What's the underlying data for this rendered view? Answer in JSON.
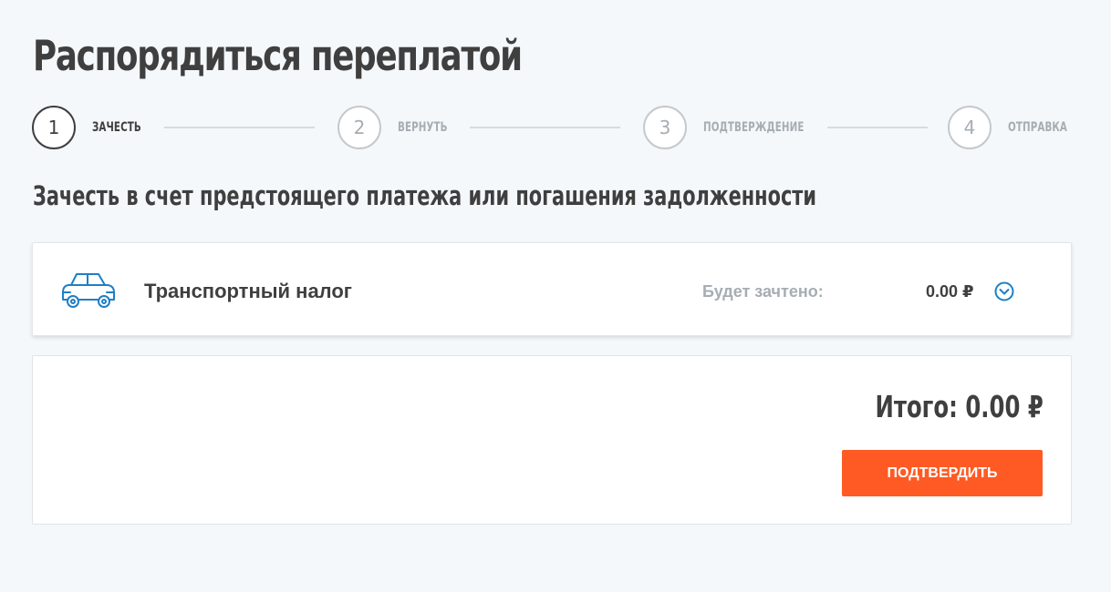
{
  "page_title": "Распорядиться переплатой",
  "stepper": {
    "steps": [
      {
        "number": "1",
        "label": "ЗАЧЕСТЬ",
        "active": true
      },
      {
        "number": "2",
        "label": "ВЕРНУТЬ",
        "active": false
      },
      {
        "number": "3",
        "label": "ПОДТВЕРЖДЕНИЕ",
        "active": false
      },
      {
        "number": "4",
        "label": "ОТПРАВКА",
        "active": false
      }
    ]
  },
  "section_title": "Зачесть в счет предстоящего платежа или погашения задолженности",
  "tax_item": {
    "icon": "car-icon",
    "name": "Транспортный налог",
    "credited_label": "Будет зачтено:",
    "credited_amount": "0.00 ₽",
    "expand_icon": "chevron-down-circle-icon"
  },
  "summary": {
    "total": "Итого: 0.00 ₽",
    "confirm_label": "ПОДТВЕРДИТЬ"
  },
  "colors": {
    "background": "#f4f8fb",
    "accent": "#ff5a24",
    "icon_blue": "#1f7fc4",
    "text_dark": "#3f3f3f",
    "text_muted": "#a6adb3"
  }
}
